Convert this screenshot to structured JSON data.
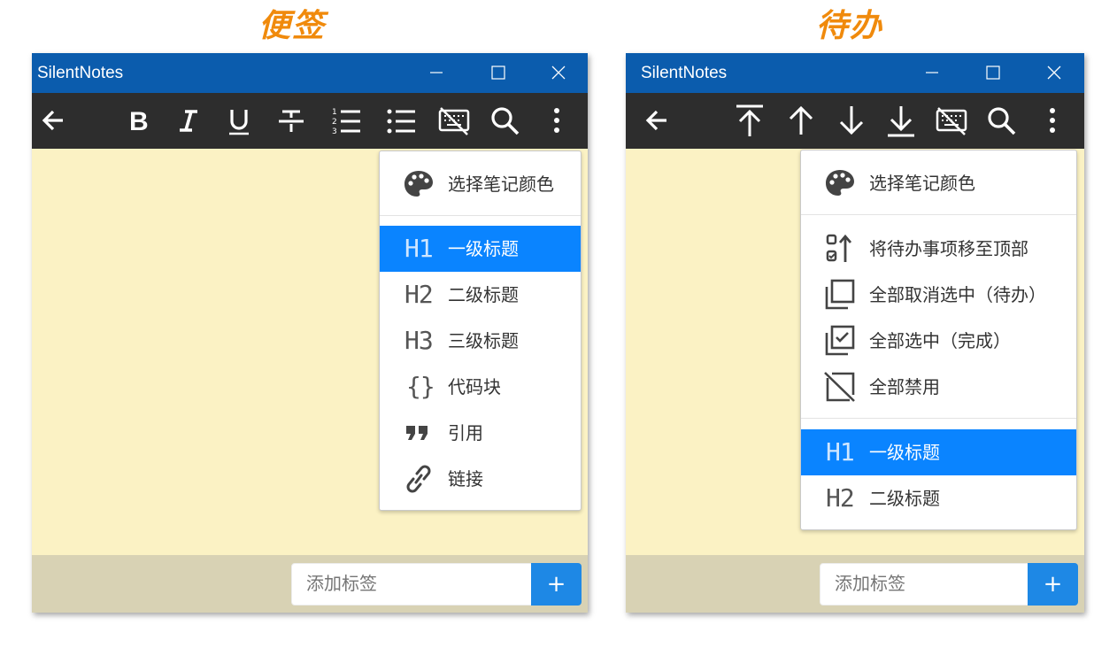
{
  "headings": {
    "left": "便签",
    "right": "待办"
  },
  "colors": {
    "titlebar": "#0b5cad",
    "toolbar": "#2d2d2d",
    "note_bg": "#fbf2c4",
    "tagbar": "#d8d2b4",
    "menu_active": "#0a84ff",
    "add_button": "#1e88e5",
    "heading": "#f08a0c"
  },
  "notes_window": {
    "title": "SilentNotes",
    "title_buttons": [
      "minimize-icon",
      "maximize-icon",
      "close-icon"
    ],
    "toolbar": [
      "back-arrow-icon",
      "bold-icon",
      "italic-icon",
      "underline-icon",
      "strikethrough-icon",
      "ordered-list-icon",
      "bullet-list-icon",
      "keyboard-off-icon",
      "search-icon",
      "more-vert-icon"
    ],
    "menu": {
      "color_item": "选择笔记颜色",
      "items": [
        {
          "glyph": "H1",
          "label": "一级标题",
          "active": true
        },
        {
          "glyph": "H2",
          "label": "二级标题"
        },
        {
          "glyph": "H3",
          "label": "三级标题"
        },
        {
          "glyph": "{}",
          "label": "代码块"
        },
        {
          "glyph": "quote-icon",
          "label": "引用"
        },
        {
          "glyph": "link-icon",
          "label": "链接"
        }
      ]
    },
    "tag_placeholder": "添加标签",
    "add_label": "+"
  },
  "todo_window": {
    "title": "SilentNotes",
    "title_buttons": [
      "minimize-icon",
      "maximize-icon",
      "close-icon"
    ],
    "toolbar": [
      "back-arrow-icon",
      "move-to-top-icon",
      "move-up-icon",
      "move-down-icon",
      "move-to-bottom-icon",
      "keyboard-off-icon",
      "search-icon",
      "more-vert-icon"
    ],
    "menu": {
      "color_item": "选择笔记颜色",
      "items": [
        {
          "icon": "checklist-up-icon",
          "label": "将待办事项移至顶部"
        },
        {
          "icon": "uncheck-all-icon",
          "label": "全部取消选中（待办）"
        },
        {
          "icon": "check-all-icon",
          "label": "全部选中（完成）"
        },
        {
          "icon": "disable-all-icon",
          "label": "全部禁用"
        }
      ],
      "heading_items": [
        {
          "glyph": "H1",
          "label": "一级标题",
          "active": true
        },
        {
          "glyph": "H2",
          "label": "二级标题"
        }
      ]
    },
    "tag_placeholder": "添加标签",
    "add_label": "+"
  }
}
